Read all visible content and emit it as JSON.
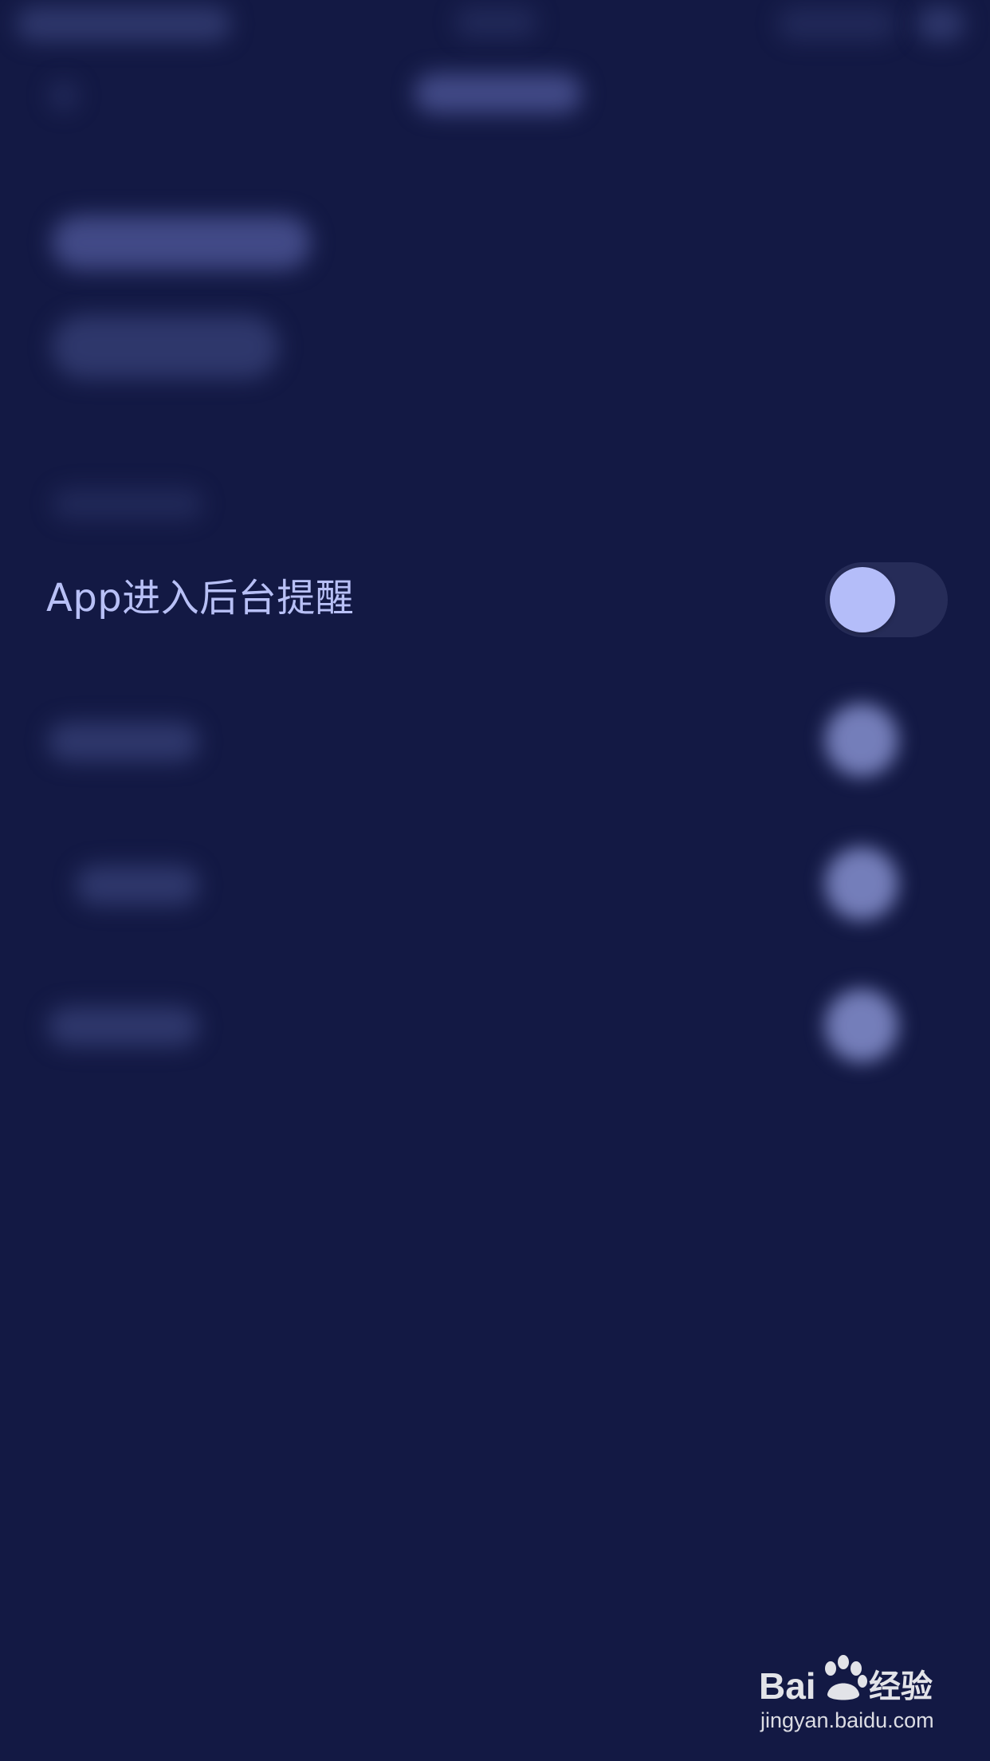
{
  "setting": {
    "label": "App进入后台提醒",
    "toggle_on": false
  },
  "watermark": {
    "logo_text": "Bai 经验",
    "url": "jingyan.baidu.com"
  },
  "colors": {
    "background": "#131944",
    "label": "#b8c0f6",
    "toggle_track": "#262c58",
    "toggle_knob": "#b4bdf9"
  }
}
